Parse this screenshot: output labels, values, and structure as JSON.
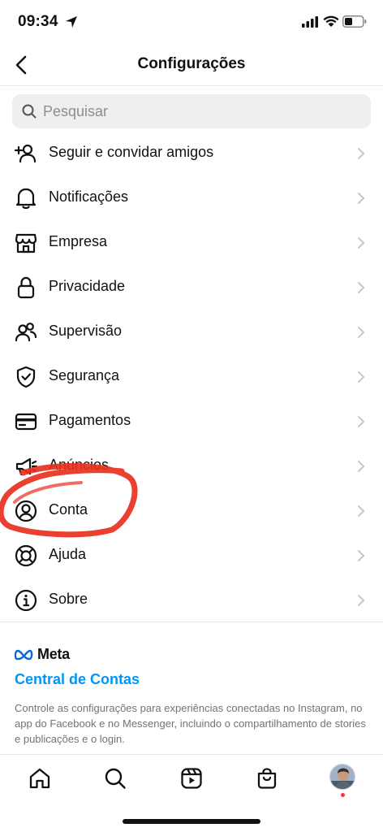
{
  "status_bar": {
    "time": "09:34"
  },
  "nav": {
    "title": "Configurações",
    "back_icon": "chevron-left-icon"
  },
  "search": {
    "placeholder": "Pesquisar",
    "value": ""
  },
  "menu": {
    "items": [
      {
        "label": "Seguir e convidar amigos",
        "icon": "add-person-icon"
      },
      {
        "label": "Notificações",
        "icon": "bell-icon"
      },
      {
        "label": "Empresa",
        "icon": "store-icon"
      },
      {
        "label": "Privacidade",
        "icon": "lock-icon"
      },
      {
        "label": "Supervisão",
        "icon": "people-icon"
      },
      {
        "label": "Segurança",
        "icon": "shield-icon"
      },
      {
        "label": "Pagamentos",
        "icon": "card-icon"
      },
      {
        "label": "Anúncios",
        "icon": "megaphone-icon"
      },
      {
        "label": "Conta",
        "icon": "account-circle-icon"
      },
      {
        "label": "Ajuda",
        "icon": "lifebuoy-icon"
      },
      {
        "label": "Sobre",
        "icon": "info-icon"
      }
    ]
  },
  "meta_section": {
    "brand": "Meta",
    "link": "Central de Contas",
    "description": "Controle as configurações para experiências conectadas no Instagram, no app do Facebook e no Messenger, incluindo o compartilhamento de stories e publicações e o login."
  },
  "tab_bar": {
    "tabs": [
      "home-icon",
      "search-icon",
      "reels-icon",
      "shop-icon",
      "profile-avatar"
    ]
  },
  "colors": {
    "link": "#0095f6",
    "annotation": "#e8301e",
    "notification_dot": "#ff3040"
  }
}
